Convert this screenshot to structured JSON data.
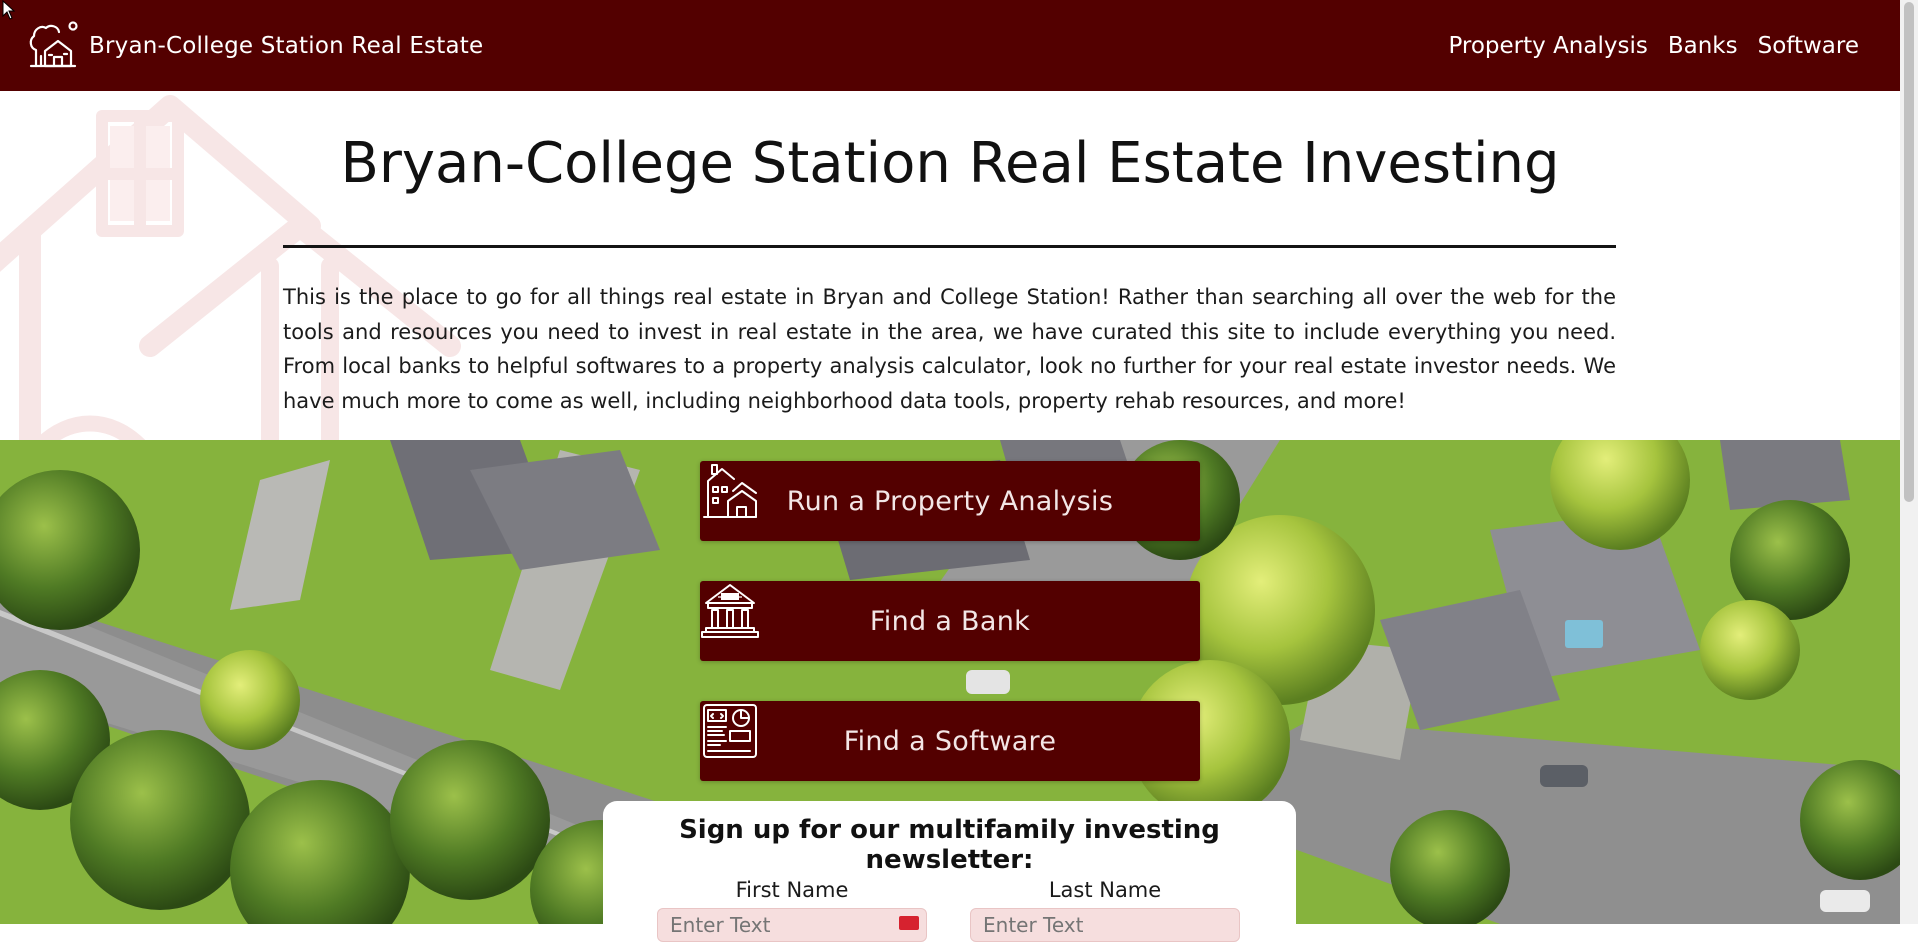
{
  "nav": {
    "brand": "Bryan-College Station Real Estate",
    "links": [
      "Property Analysis",
      "Banks",
      "Software"
    ]
  },
  "hero": {
    "title": "Bryan-College Station Real Estate Investing",
    "intro": "This is the place to go for all things real estate in Bryan and College Station! Rather than searching all over the web for the tools and resources you need to invest in real estate in the area, we have curated this site to include everything you need. From local banks to helpful softwares to a property analysis calculator, look no further for your real estate investor needs. We have much more to come as well, including neighborhood data tools, property rehab resources, and more!"
  },
  "actions": [
    {
      "label": "Run a Property Analysis",
      "icon": "house-analysis-icon"
    },
    {
      "label": "Find a Bank",
      "icon": "bank-icon"
    },
    {
      "label": "Find a Software",
      "icon": "software-dashboard-icon"
    }
  ],
  "newsletter": {
    "heading": "Sign up for our multifamily investing newsletter:",
    "first_name_label": "First Name",
    "last_name_label": "Last Name",
    "first_name_placeholder": "Enter Text",
    "last_name_placeholder": "Enter Text"
  },
  "colors": {
    "brand": "#530000",
    "background": "#ffffff",
    "input_fill": "#f6dede",
    "required_flag": "#d6222f"
  }
}
